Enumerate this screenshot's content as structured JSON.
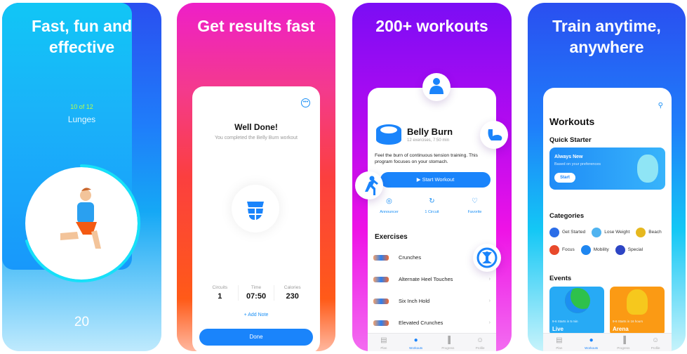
{
  "panels": [
    {
      "headline": "Fast, fun and effective",
      "exercise": {
        "counter": "10 of 12",
        "name": "Lunges",
        "reps": "20",
        "progress_fraction": 0.7
      }
    },
    {
      "headline": "Get results fast",
      "menu_icon": "more-dots-icon",
      "title": "Well Done!",
      "subtitle": "You completed the Belly Burn workout",
      "stats": [
        {
          "label": "Circuits",
          "value": "1"
        },
        {
          "label": "Time",
          "value": "07:50"
        },
        {
          "label": "Calories",
          "value": "230"
        }
      ],
      "add_note": "+ Add Note",
      "done": "Done"
    },
    {
      "headline": "200+ workouts",
      "workout": {
        "title": "Belly Burn",
        "meta": "12 exercises, 7:50 min",
        "description": "Feel the burn of continuous tension training. This program focuses on your stomach.",
        "start": "▶  Start Workout"
      },
      "actions": [
        {
          "label": "Announcer",
          "icon": "◎"
        },
        {
          "label": "1 Circuit",
          "icon": "↻"
        },
        {
          "label": "Favorite",
          "icon": "♡"
        }
      ],
      "exercises_title": "Exercises",
      "exercises": [
        "Crunches",
        "Alternate Heel Touches",
        "Six Inch Hold",
        "Elevated Crunches"
      ],
      "chevron": "›"
    },
    {
      "headline": "Train anytime, anywhere",
      "title": "Workouts",
      "quick_starter": {
        "title": "Quick Starter",
        "card_title": "Always New",
        "card_sub": "Based on your preferences",
        "button": "Start"
      },
      "categories_title": "Categories",
      "categories": [
        [
          {
            "label": "Get Started",
            "color": "#2b6de8"
          },
          {
            "label": "Lose Weight",
            "color": "#4fb3f0"
          },
          {
            "label": "Beach",
            "color": "#e6b81f"
          }
        ],
        [
          {
            "label": "Focus",
            "color": "#e8492b"
          },
          {
            "label": "Mobility",
            "color": "#1f86f0"
          },
          {
            "label": "Special",
            "color": "#2d45c4"
          }
        ]
      ],
      "events_title": "Events",
      "events": [
        {
          "schedule": "9-6 Starts in 5 min",
          "name": "Live",
          "color": "#27aaf5"
        },
        {
          "schedule": "9-6 Starts in 16 hours",
          "name": "Arena",
          "color": "#fb9a14"
        }
      ]
    }
  ],
  "tabbar": [
    {
      "label": "Plan",
      "icon": "▤"
    },
    {
      "label": "Workouts",
      "icon": "●"
    },
    {
      "label": "Progress",
      "icon": "▐"
    },
    {
      "label": "Profile",
      "icon": "☺"
    }
  ]
}
